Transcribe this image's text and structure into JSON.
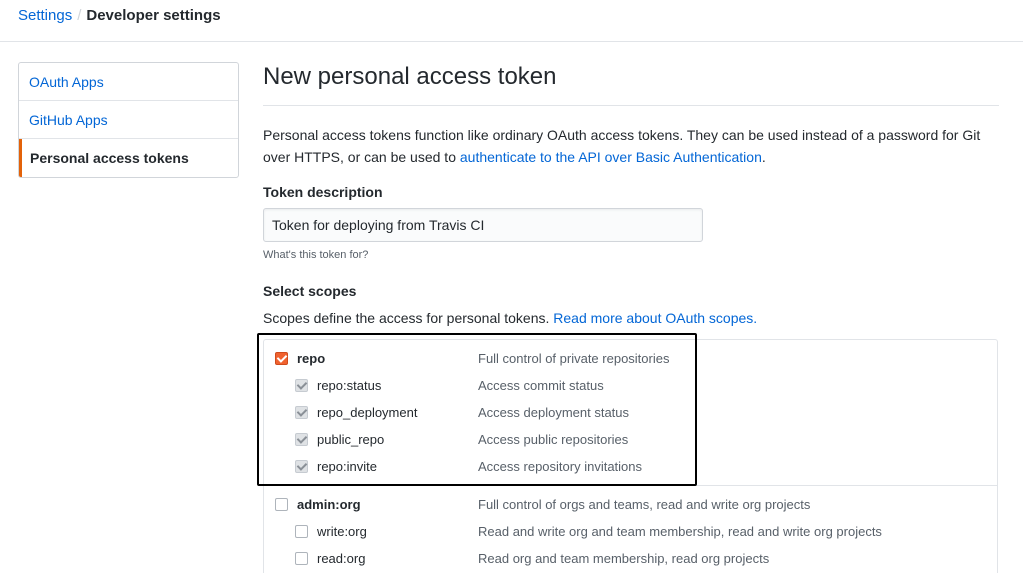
{
  "breadcrumb": {
    "settings": "Settings",
    "separator": "/",
    "current": "Developer settings"
  },
  "sidebar": {
    "items": [
      {
        "label": "OAuth Apps"
      },
      {
        "label": "GitHub Apps"
      },
      {
        "label": "Personal access tokens",
        "selected": true
      }
    ]
  },
  "main": {
    "title": "New personal access token",
    "intro_text": "Personal access tokens function like ordinary OAuth access tokens. They can be used instead of a password for Git over HTTPS, or can be used to ",
    "intro_link": "authenticate to the API over Basic Authentication",
    "intro_end": ".",
    "token_label": "Token description",
    "token_value": "Token for deploying from Travis CI",
    "token_note": "What's this token for?",
    "scopes_label": "Select scopes",
    "scopes_desc": "Scopes define the access for personal tokens. ",
    "scopes_link": "Read more about OAuth scopes."
  },
  "scopes": [
    {
      "name": "repo",
      "description": "Full control of private repositories",
      "checked": true,
      "children": [
        {
          "name": "repo:status",
          "description": "Access commit status",
          "checked": true
        },
        {
          "name": "repo_deployment",
          "description": "Access deployment status",
          "checked": true
        },
        {
          "name": "public_repo",
          "description": "Access public repositories",
          "checked": true
        },
        {
          "name": "repo:invite",
          "description": "Access repository invitations",
          "checked": true
        }
      ]
    },
    {
      "name": "admin:org",
      "description": "Full control of orgs and teams, read and write org projects",
      "checked": false,
      "children": [
        {
          "name": "write:org",
          "description": "Read and write org and team membership, read and write org projects",
          "checked": false
        },
        {
          "name": "read:org",
          "description": "Read org and team membership, read org projects",
          "checked": false
        }
      ]
    }
  ],
  "colors": {
    "link": "#0366d6",
    "accent": "#e36209",
    "checkbox_checked": "#f0622f",
    "highlight_border": "#000000"
  }
}
